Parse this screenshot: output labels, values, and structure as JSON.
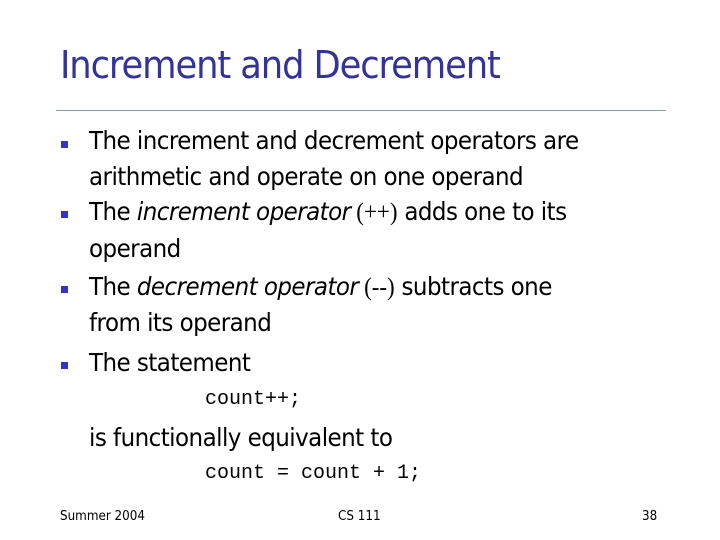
{
  "slide": {
    "title": "Increment and Decrement",
    "accent_color": "#333399",
    "bullet_color": "#3333cc",
    "bullets": [
      {
        "lines": [
          "The increment and decrement operators are",
          "arithmetic and operate on one operand"
        ]
      },
      {
        "prefix": "The ",
        "term": "increment operator",
        "operator": " (++)",
        "suffix": " adds one to its",
        "line2": "operand"
      },
      {
        "prefix": "The ",
        "term": "decrement operator",
        "operator": " (--)",
        "suffix": " subtracts one",
        "line2": "from its operand"
      },
      {
        "lines": [
          "The statement"
        ]
      }
    ],
    "code_1": "count++;",
    "continuation": "is functionally equivalent to",
    "code_2": "count = count + 1;"
  },
  "footer": {
    "left": "Summer 2004",
    "center": "CS 111",
    "right": "38"
  }
}
